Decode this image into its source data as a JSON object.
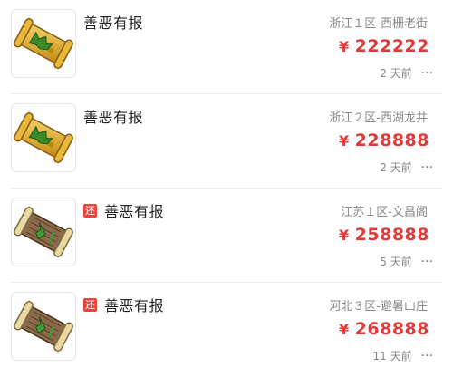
{
  "currency_symbol": "¥",
  "more_glyph": "···",
  "return_badge_text": "还",
  "colors": {
    "price": "#e03b3b",
    "badge": "#e8453c",
    "scroll_gold": "#d9a520",
    "scroll_brown": "#7a5a3a"
  },
  "items": [
    {
      "title": "善恶有报",
      "server": "浙江１区-西栅老街",
      "price": "222222",
      "time": "2 天前",
      "has_return_badge": false,
      "icon": "gold-scroll-icon"
    },
    {
      "title": "善恶有报",
      "server": "浙江２区-西湖龙井",
      "price": "228888",
      "time": "2 天前",
      "has_return_badge": false,
      "icon": "gold-scroll-icon"
    },
    {
      "title": "善恶有报",
      "server": "江苏１区-文昌阁",
      "price": "258888",
      "time": "5 天前",
      "has_return_badge": true,
      "icon": "brown-scroll-icon"
    },
    {
      "title": "善恶有报",
      "server": "河北３区-避暑山庄",
      "price": "268888",
      "time": "11 天前",
      "has_return_badge": true,
      "icon": "brown-scroll-icon"
    }
  ]
}
